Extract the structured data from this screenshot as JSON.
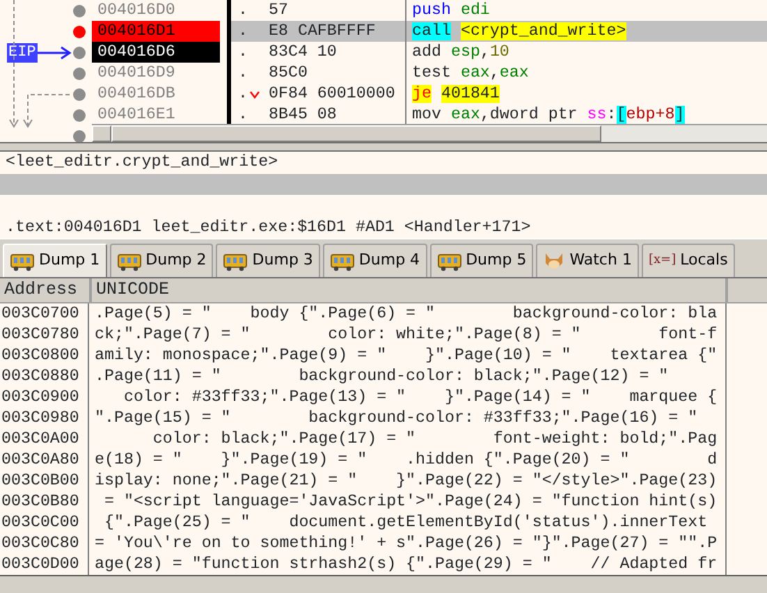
{
  "disassembly": {
    "eip_label": "EIP",
    "rows": [
      {
        "address": "004016D0",
        "breakpoint": false,
        "eip": false,
        "selected": false,
        "prefix": ".",
        "bytes": "57",
        "mnemonic": {
          "text": "push",
          "kind": "push"
        },
        "operands": [
          {
            "text": "edi",
            "kind": "register"
          }
        ]
      },
      {
        "address": "004016D1",
        "breakpoint": true,
        "eip": false,
        "selected": true,
        "prefix": ".",
        "bytes": "E8 CAFBFFFF",
        "mnemonic": {
          "text": "call",
          "kind": "call"
        },
        "operands": [
          {
            "text": "<crypt_and_write>",
            "kind": "label"
          }
        ]
      },
      {
        "address": "004016D6",
        "breakpoint": false,
        "eip": true,
        "selected": false,
        "prefix": ".",
        "bytes": "83C4 10",
        "mnemonic": {
          "text": "add",
          "kind": "plain"
        },
        "operands": [
          {
            "text": "esp",
            "kind": "register"
          },
          {
            "text": ",",
            "kind": "plain"
          },
          {
            "text": "10",
            "kind": "number"
          }
        ]
      },
      {
        "address": "004016D9",
        "breakpoint": false,
        "eip": false,
        "selected": false,
        "prefix": ".",
        "bytes": "85C0",
        "mnemonic": {
          "text": "test",
          "kind": "plain"
        },
        "operands": [
          {
            "text": "eax",
            "kind": "register"
          },
          {
            "text": ",",
            "kind": "plain"
          },
          {
            "text": "eax",
            "kind": "register"
          }
        ]
      },
      {
        "address": "004016DB",
        "breakpoint": false,
        "eip": false,
        "selected": false,
        "prefix": ".",
        "branch": true,
        "bytes": "0F84 60010000",
        "mnemonic": {
          "text": "je",
          "kind": "jump"
        },
        "operands": [
          {
            "text": "401841",
            "kind": "target"
          }
        ]
      },
      {
        "address": "004016E1",
        "breakpoint": false,
        "eip": false,
        "selected": false,
        "prefix": ".",
        "bytes": "8B45 08",
        "mnemonic": {
          "text": "mov",
          "kind": "plain"
        },
        "operands": [
          {
            "text": "eax",
            "kind": "register"
          },
          {
            "text": ",dword ptr ",
            "kind": "plain"
          },
          {
            "text": "ss",
            "kind": "segment"
          },
          {
            "text": ":",
            "kind": "plain"
          },
          {
            "text": "[",
            "kind": "bracket"
          },
          {
            "text": "ebp+8",
            "kind": "memory"
          },
          {
            "text": "]",
            "kind": "bracket"
          }
        ]
      },
      {
        "breakpoint": false
      }
    ]
  },
  "info": {
    "lines": [
      {
        "text": "<leet_editr.crypt_and_write>",
        "selected": false
      },
      {
        "selected": true
      },
      {
        "selected": false
      },
      {
        "text": ".text:004016D1 leet_editr.exe:$16D1 #AD1 <Handler+171>",
        "selected": false
      }
    ]
  },
  "tabs": [
    {
      "label": "Dump 1",
      "kind": "dump",
      "selected": true
    },
    {
      "label": "Dump 2",
      "kind": "dump",
      "selected": false
    },
    {
      "label": "Dump 3",
      "kind": "dump",
      "selected": false
    },
    {
      "label": "Dump 4",
      "kind": "dump",
      "selected": false
    },
    {
      "label": "Dump 5",
      "kind": "dump",
      "selected": false
    },
    {
      "label": "Watch 1",
      "kind": "watch",
      "selected": false
    },
    {
      "label": "Locals",
      "kind": "locals",
      "icon_text": "[x=]",
      "selected": false
    }
  ],
  "dump": {
    "columns": [
      "Address",
      "UNICODE"
    ],
    "rows": [
      {
        "address": "003C0700",
        "text": ".Page(5) = \"    body {\".Page(6) = \"        background-color: bla"
      },
      {
        "address": "003C0780",
        "text": "ck;\".Page(7) = \"        color: white;\".Page(8) = \"        font-f"
      },
      {
        "address": "003C0800",
        "text": "amily: monospace;\".Page(9) = \"    }\".Page(10) = \"    textarea {\""
      },
      {
        "address": "003C0880",
        "text": ".Page(11) = \"        background-color: black;\".Page(12) = \""
      },
      {
        "address": "003C0900",
        "text": "   color: #33ff33;\".Page(13) = \"    }\".Page(14) = \"    marquee {"
      },
      {
        "address": "003C0980",
        "text": "\".Page(15) = \"        background-color: #33ff33;\".Page(16) = \""
      },
      {
        "address": "003C0A00",
        "text": "      color: black;\".Page(17) = \"        font-weight: bold;\".Pag"
      },
      {
        "address": "003C0A80",
        "text": "e(18) = \"    }\".Page(19) = \"    .hidden {\".Page(20) = \"        d"
      },
      {
        "address": "003C0B00",
        "text": "isplay: none;\".Page(21) = \"    }\".Page(22) = \"</style>\".Page(23)"
      },
      {
        "address": "003C0B80",
        "text": " = \"<script language='JavaScript'>\".Page(24) = \"function hint(s)"
      },
      {
        "address": "003C0C00",
        "text": " {\".Page(25) = \"    document.getElementById('status').innerText"
      },
      {
        "address": "003C0C80",
        "text": "= 'You\\'re on to something!' + s\".Page(26) = \"}\".Page(27) = \"\".P"
      },
      {
        "address": "003C0D00",
        "text": "age(28) = \"function strhash2(s) {\".Page(29) = \"    // Adapted fr"
      }
    ]
  }
}
